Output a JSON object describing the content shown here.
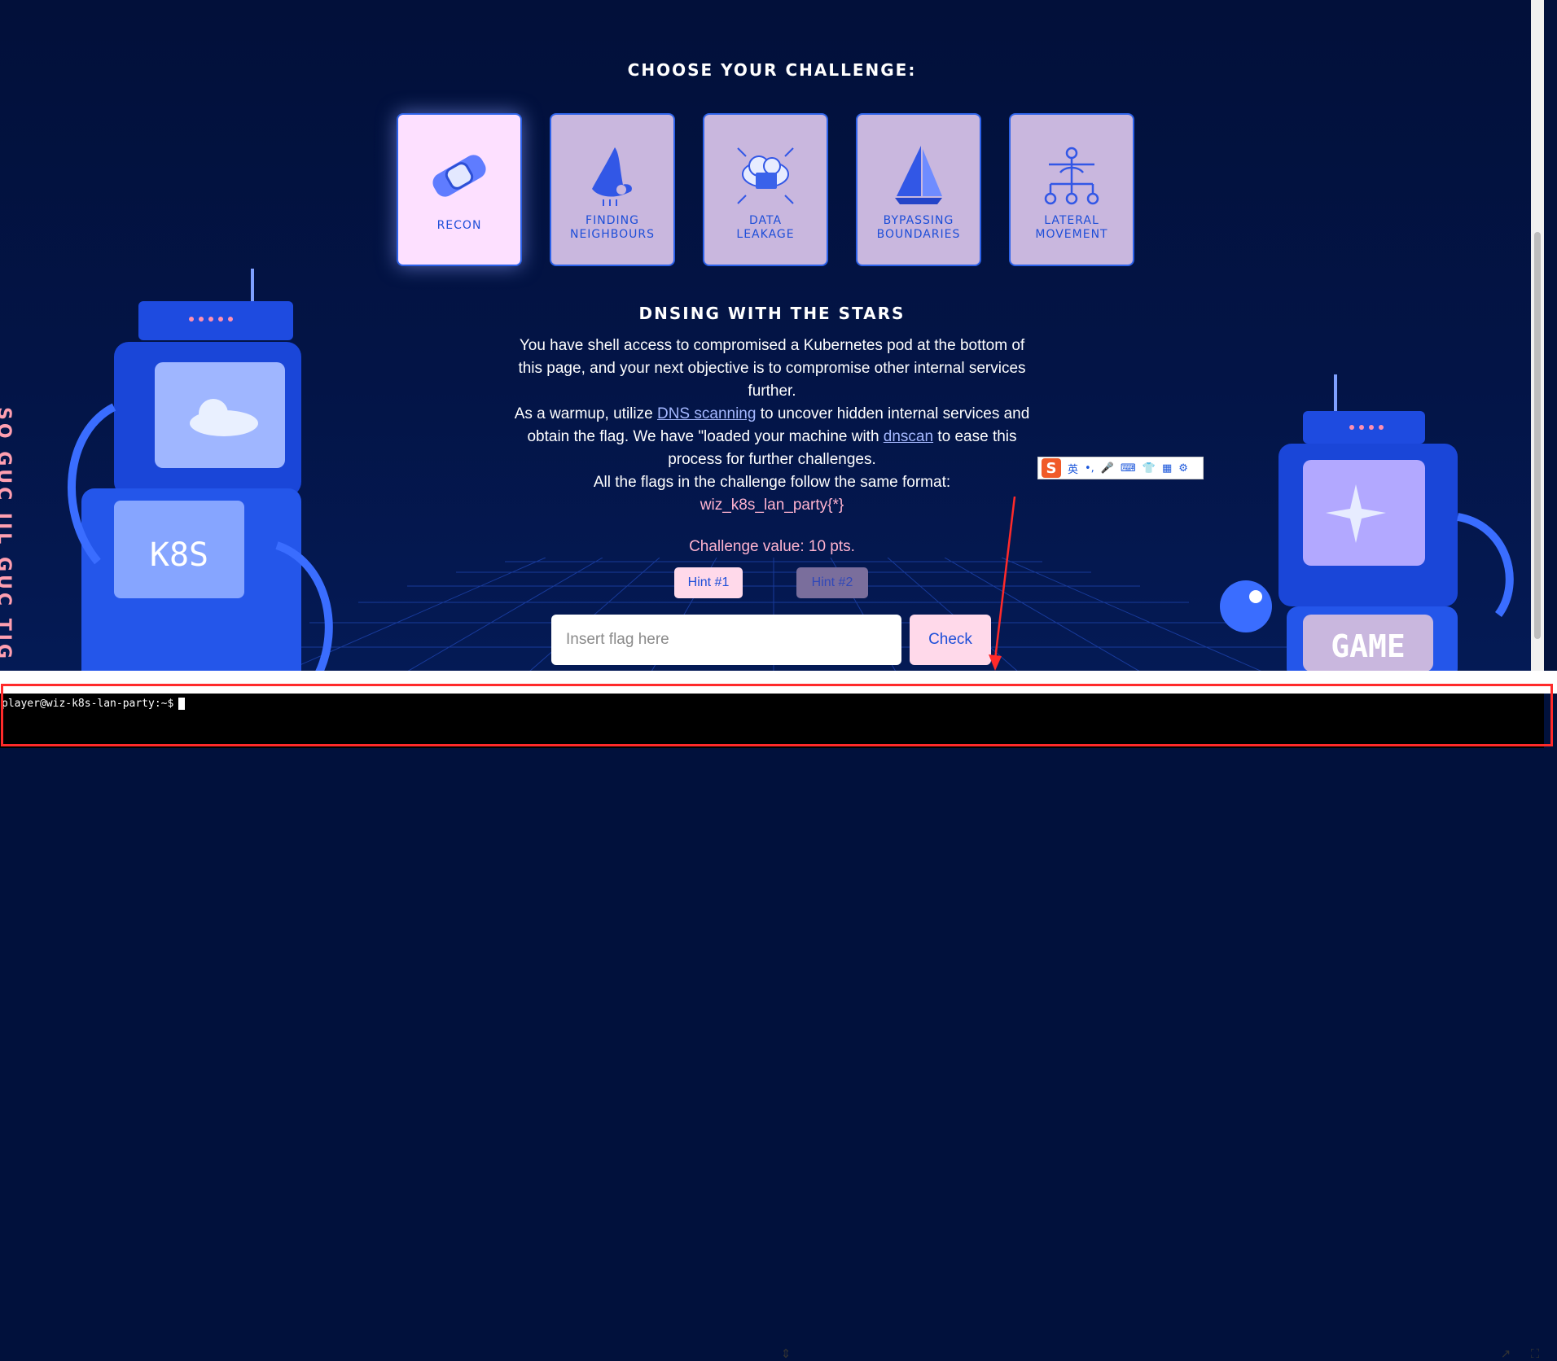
{
  "page": {
    "heading": "CHOOSE YOUR CHALLENGE:",
    "challenges": [
      {
        "label_line1": "RECON",
        "label_line2": "",
        "icon": "recon-bandage-icon",
        "active": true
      },
      {
        "label_line1": "FINDING",
        "label_line2": "NEIGHBOURS",
        "icon": "nose-icon",
        "active": false
      },
      {
        "label_line1": "DATA",
        "label_line2": "LEAKAGE",
        "icon": "cloud-folder-icon",
        "active": false
      },
      {
        "label_line1": "BYPASSING",
        "label_line2": "BOUNDARIES",
        "icon": "sailboat-icon",
        "active": false
      },
      {
        "label_line1": "LATERAL",
        "label_line2": "MOVEMENT",
        "icon": "network-robot-icon",
        "active": false
      }
    ],
    "challenge_title": "DNSING WITH THE STARS",
    "desc": {
      "p1": "You have shell access to compromised a Kubernetes pod at the bottom of this page, and your next objective is to compromise other internal services further.",
      "p2_before": "As a warmup, utilize ",
      "p2_link1": "DNS scanning",
      "p2_middle": " to uncover hidden internal services and obtain the flag. We have \"loaded your machine with ",
      "p2_link2": "dnscan",
      "p2_after": " to ease this process for further challenges.",
      "p3": "All the flags in the challenge follow the same format:",
      "flag_format": "wiz_k8s_lan_party{*}"
    },
    "challenge_value": "Challenge value: 10 pts.",
    "hint1": "Hint #1",
    "hint2": "Hint #2",
    "flag_placeholder": "Insert flag here",
    "check_button": "Check",
    "robot_left_screen_text": "K8S",
    "robot_right_screen_text": "GAME"
  },
  "ime_toolbar": {
    "logo": "S",
    "lang": "英",
    "punct": "•,"
  },
  "terminal": {
    "prompt": "player@wiz-k8s-lan-party:~$"
  },
  "colors": {
    "background": "#01113c",
    "card": "#c9b7de",
    "card_active": "#fde0ff",
    "accent_blue": "#1d4ed8",
    "pink_text": "#ffb3cf",
    "annotation_red": "#ff2a2a"
  }
}
